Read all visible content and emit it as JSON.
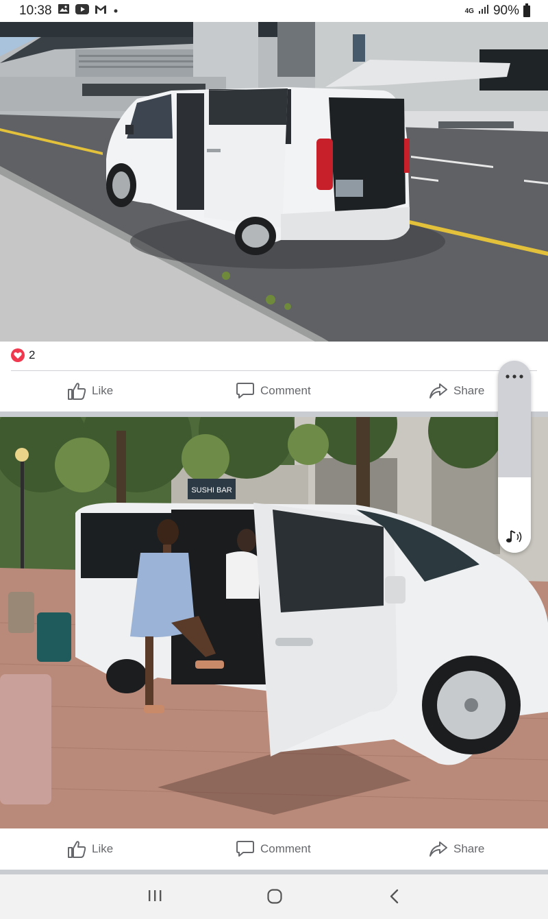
{
  "status_bar": {
    "time": "10:38",
    "network": "4G",
    "battery": "90%",
    "icons": [
      "gallery-icon",
      "youtube-icon",
      "gmail-icon",
      "dot-icon",
      "signal-icon",
      "battery-icon"
    ]
  },
  "posts": [
    {
      "photo_description_icon": "photo-white-van-airport",
      "reaction_count": "2",
      "reaction_icon": "love-icon",
      "actions": {
        "like": "Like",
        "comment": "Comment",
        "share": "Share"
      }
    },
    {
      "photo_description_icon": "photo-van-woman-street",
      "sign_text": "SUSHI BAR",
      "actions": {
        "like": "Like",
        "comment": "Comment",
        "share": "Share"
      }
    }
  ],
  "floating_control": {
    "menu_icon": "more-dots-icon",
    "sound_icon": "music-note-icon"
  },
  "nav_bar": {
    "icons": [
      "recent-apps-icon",
      "home-icon",
      "back-icon"
    ]
  },
  "colors": {
    "accent_heart": "#f0394f",
    "action_text": "#65676b",
    "feed_background": "#c9ccd1"
  }
}
